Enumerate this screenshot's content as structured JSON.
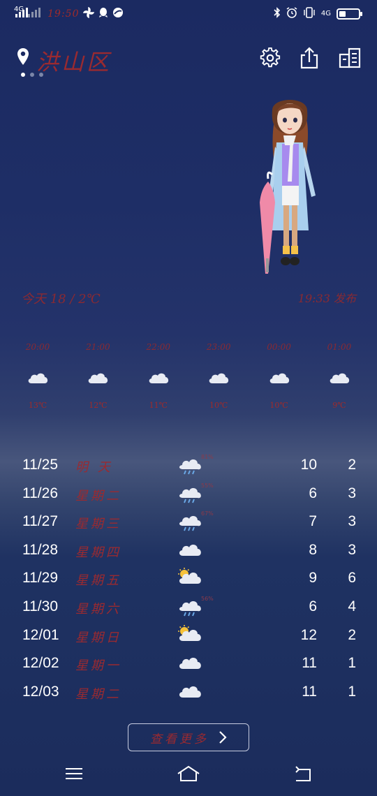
{
  "status_bar": {
    "network_left": "4G",
    "time": "19:50",
    "network_right": "4G",
    "battery_level": 0.35
  },
  "header": {
    "city": "洪山区",
    "pages": 3,
    "active_page": 0
  },
  "today": {
    "condition_temp": "今天  18 / 2℃",
    "published": "19:33 发布"
  },
  "hourly": [
    {
      "time": "20:00",
      "icon": "cloud-icon",
      "temp": "13℃"
    },
    {
      "time": "21:00",
      "icon": "cloud-icon",
      "temp": "12℃"
    },
    {
      "time": "22:00",
      "icon": "cloud-icon",
      "temp": "11℃"
    },
    {
      "time": "23:00",
      "icon": "cloud-icon",
      "temp": "10℃"
    },
    {
      "time": "00:00",
      "icon": "cloud-icon",
      "temp": "10℃"
    },
    {
      "time": "01:00",
      "icon": "cloud-icon",
      "temp": "9℃"
    }
  ],
  "daily": [
    {
      "date": "11/25",
      "weekday": "明  天",
      "icon": "rain-icon",
      "precip": "81%",
      "high": "10",
      "low": "2"
    },
    {
      "date": "11/26",
      "weekday": "星期二",
      "icon": "rain-icon",
      "precip": "55%",
      "high": "6",
      "low": "3"
    },
    {
      "date": "11/27",
      "weekday": "星期三",
      "icon": "rain-icon",
      "precip": "67%",
      "high": "7",
      "low": "3"
    },
    {
      "date": "11/28",
      "weekday": "星期四",
      "icon": "cloud-icon",
      "precip": "",
      "high": "8",
      "low": "3"
    },
    {
      "date": "11/29",
      "weekday": "星期五",
      "icon": "partly-cloudy-icon",
      "precip": "",
      "high": "9",
      "low": "6"
    },
    {
      "date": "11/30",
      "weekday": "星期六",
      "icon": "rain-icon",
      "precip": "56%",
      "high": "6",
      "low": "4"
    },
    {
      "date": "12/01",
      "weekday": "星期日",
      "icon": "partly-cloudy-icon",
      "precip": "",
      "high": "12",
      "low": "2"
    },
    {
      "date": "12/02",
      "weekday": "星期一",
      "icon": "cloud-icon",
      "precip": "",
      "high": "11",
      "low": "1"
    },
    {
      "date": "12/03",
      "weekday": "星期二",
      "icon": "cloud-icon",
      "precip": "",
      "high": "11",
      "low": "1"
    }
  ],
  "more_button": {
    "label": "查看更多"
  },
  "colors": {
    "accent_red": "#9a2a30",
    "background_top": "#1b2a61",
    "cloud": "#e8ebf3"
  }
}
